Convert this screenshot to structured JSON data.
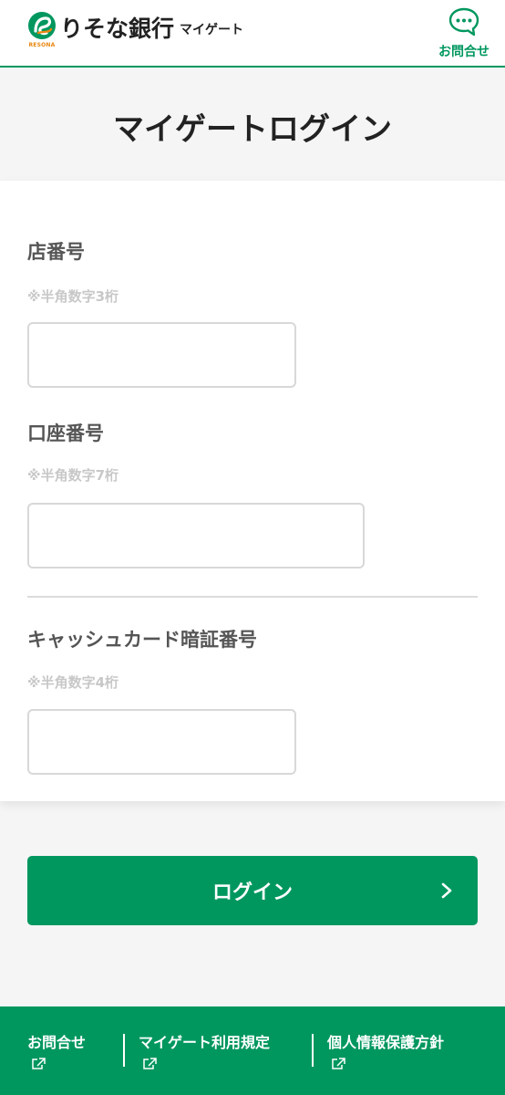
{
  "header": {
    "bank_name": "りそな銀行",
    "logo_sub": "RESONA",
    "service_name": "マイゲート",
    "contact_label": "お問合せ"
  },
  "page": {
    "title": "マイゲートログイン"
  },
  "form": {
    "branch": {
      "label": "店番号",
      "hint": "※半角数字3桁",
      "value": ""
    },
    "account": {
      "label": "口座番号",
      "hint": "※半角数字7桁",
      "value": ""
    },
    "pin": {
      "label": "キャッシュカード暗証番号",
      "hint": "※半角数字4桁",
      "value": ""
    }
  },
  "login_button": {
    "label": "ログイン"
  },
  "footer": {
    "links": [
      {
        "label": "お問合せ"
      },
      {
        "label": "マイゲート利用規定"
      },
      {
        "label": "個人情報保護方針"
      }
    ]
  },
  "colors": {
    "brand_green": "#00975f",
    "logo_orange": "#e8860f",
    "background": "#f5f5f5"
  },
  "icons": {
    "contact": "chat-bubble-icon",
    "login_arrow": "chevron-right-icon",
    "external": "external-link-icon"
  }
}
